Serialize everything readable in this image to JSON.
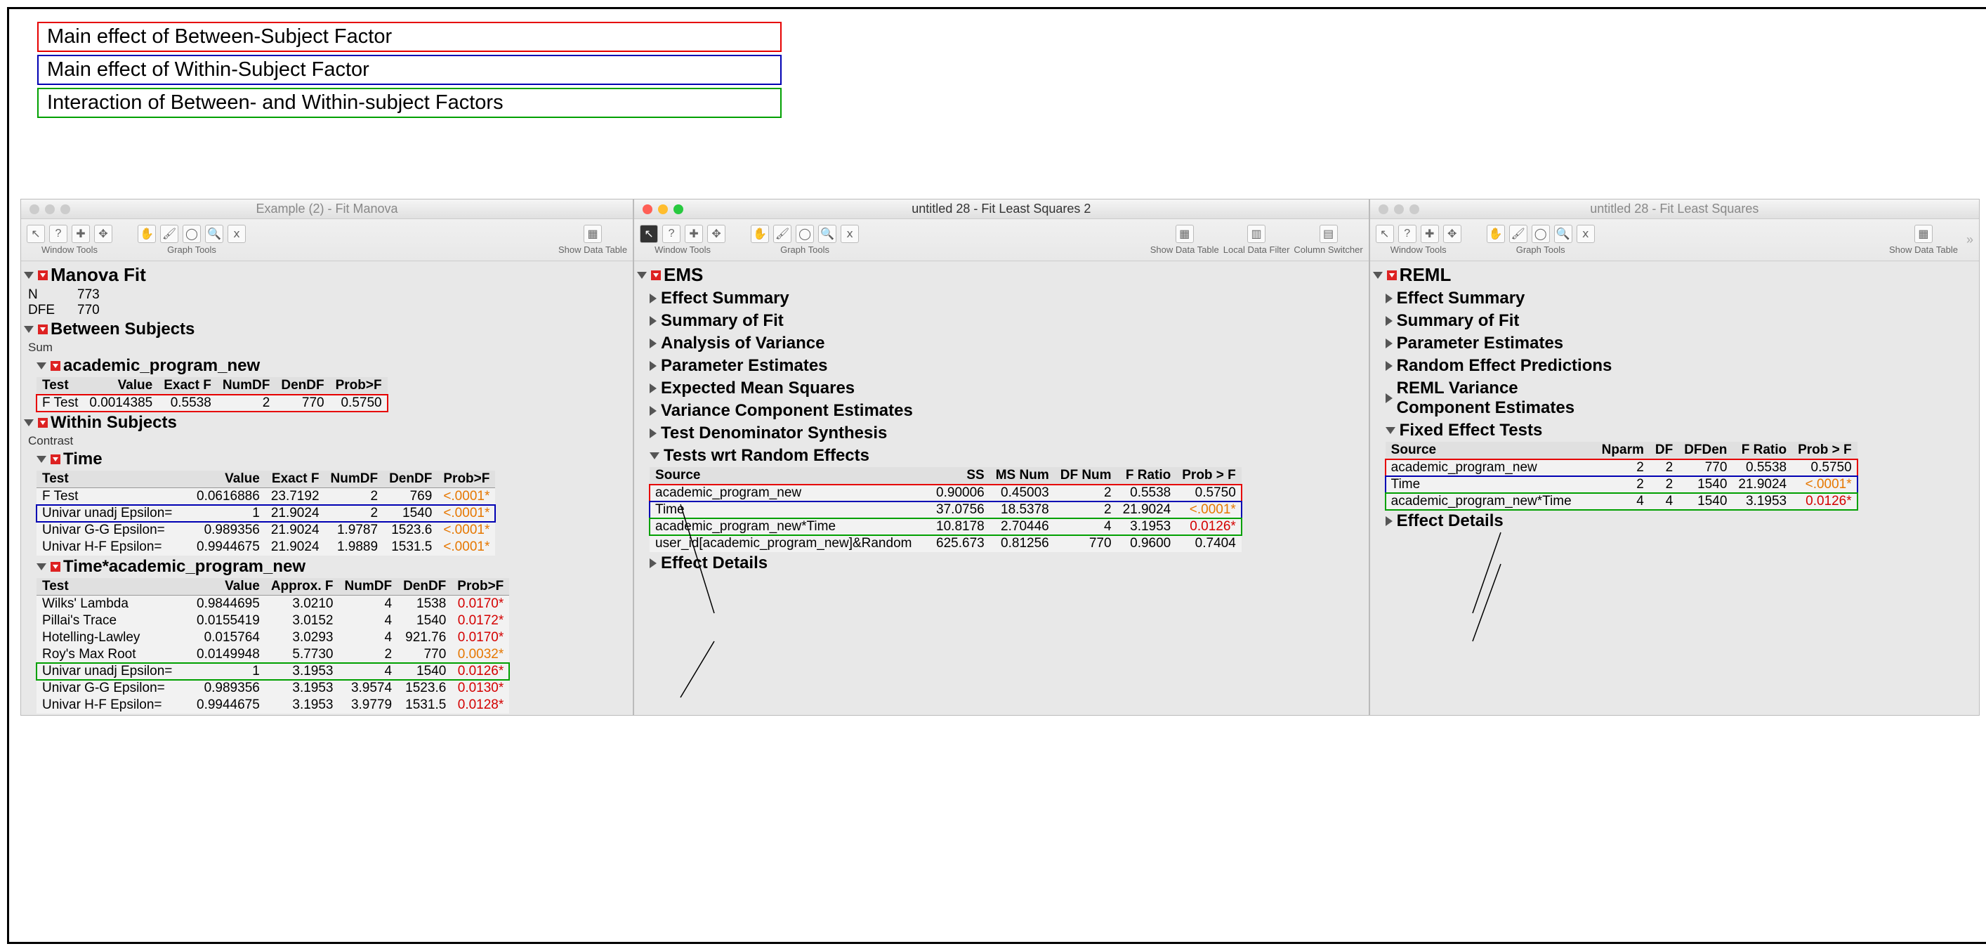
{
  "legend": {
    "between": "Main effect of Between-Subject Factor",
    "within": "Main effect of Within-Subject Factor",
    "interaction": "Interaction of Between- and Within-subject Factors"
  },
  "win1": {
    "title": "Example (2) - Fit Manova",
    "toolbar": {
      "window": "Window Tools",
      "graph": "Graph Tools",
      "show": "Show Data Table"
    },
    "header": "Manova Fit",
    "n_label": "N",
    "n": "773",
    "dfe_label": "DFE",
    "dfe": "770",
    "between_hdr": "Between Subjects",
    "sum": "Sum",
    "apn": "academic_program_new",
    "cols_ftest": {
      "test": "Test",
      "value": "Value",
      "exactf": "Exact F",
      "numdf": "NumDF",
      "dendf": "DenDF",
      "prob": "Prob>F"
    },
    "ftest_row": {
      "test": "F Test",
      "value": "0.0014385",
      "exactf": "0.5538",
      "numdf": "2",
      "dendf": "770",
      "prob": "0.5750"
    },
    "within_hdr": "Within Subjects",
    "contrast": "Contrast",
    "time_hdr": "Time",
    "time_rows": [
      {
        "test": "F Test",
        "value": "0.0616886",
        "exactf": "23.7192",
        "numdf": "2",
        "dendf": "769",
        "prob": "<.0001*",
        "cls": "sig-orange"
      },
      {
        "test": "Univar unadj Epsilon=",
        "value": "1",
        "exactf": "21.9024",
        "numdf": "2",
        "dendf": "1540",
        "prob": "<.0001*",
        "cls": "sig-orange",
        "hl": "hlb"
      },
      {
        "test": "Univar G-G   Epsilon=",
        "value": "0.989356",
        "exactf": "21.9024",
        "numdf": "1.9787",
        "dendf": "1523.6",
        "prob": "<.0001*",
        "cls": "sig-orange"
      },
      {
        "test": "Univar H-F   Epsilon=",
        "value": "0.9944675",
        "exactf": "21.9024",
        "numdf": "1.9889",
        "dendf": "1531.5",
        "prob": "<.0001*",
        "cls": "sig-orange"
      }
    ],
    "tap_hdr": "Time*academic_program_new",
    "cols_approx": {
      "test": "Test",
      "value": "Value",
      "approxf": "Approx. F",
      "numdf": "NumDF",
      "dendf": "DenDF",
      "prob": "Prob>F"
    },
    "tap_rows": [
      {
        "test": "Wilks' Lambda",
        "value": "0.9844695",
        "f": "3.0210",
        "numdf": "4",
        "dendf": "1538",
        "prob": "0.0170*",
        "cls": "sig-red"
      },
      {
        "test": "Pillai's Trace",
        "value": "0.0155419",
        "f": "3.0152",
        "numdf": "4",
        "dendf": "1540",
        "prob": "0.0172*",
        "cls": "sig-red"
      },
      {
        "test": "Hotelling-Lawley",
        "value": "0.015764",
        "f": "3.0293",
        "numdf": "4",
        "dendf": "921.76",
        "prob": "0.0170*",
        "cls": "sig-red"
      },
      {
        "test": "Roy's Max Root",
        "value": "0.0149948",
        "f": "5.7730",
        "numdf": "2",
        "dendf": "770",
        "prob": "0.0032*",
        "cls": "sig-orange"
      },
      {
        "test": "Univar unadj Epsilon=",
        "value": "1",
        "f": "3.1953",
        "numdf": "4",
        "dendf": "1540",
        "prob": "0.0126*",
        "cls": "sig-red",
        "hl": "hlg"
      },
      {
        "test": "Univar G-G   Epsilon=",
        "value": "0.989356",
        "f": "3.1953",
        "numdf": "3.9574",
        "dendf": "1523.6",
        "prob": "0.0130*",
        "cls": "sig-red"
      },
      {
        "test": "Univar H-F   Epsilon=",
        "value": "0.9944675",
        "f": "3.1953",
        "numdf": "3.9779",
        "dendf": "1531.5",
        "prob": "0.0128*",
        "cls": "sig-red"
      }
    ]
  },
  "win2": {
    "title": "untitled 28 - Fit Least Squares 2",
    "toolbar": {
      "window": "Window Tools",
      "graph": "Graph Tools",
      "show": "Show Data Table",
      "filter": "Local Data Filter",
      "cols": "Column Switcher"
    },
    "header": "EMS",
    "sections": [
      "Effect Summary",
      "Summary of Fit",
      "Analysis of Variance",
      "Parameter Estimates",
      "Expected Mean Squares",
      "Variance Component Estimates",
      "Test Denominator Synthesis"
    ],
    "tests_hdr": "Tests wrt Random Effects",
    "cols": {
      "source": "Source",
      "ss": "SS",
      "msnum": "MS Num",
      "dfnum": "DF Num",
      "fratio": "F Ratio",
      "prob": "Prob > F"
    },
    "rows": [
      {
        "source": "academic_program_new",
        "ss": "0.90006",
        "ms": "0.45003",
        "df": "2",
        "f": "0.5538",
        "p": "0.5750",
        "hl": "hlr"
      },
      {
        "source": "Time",
        "ss": "37.0756",
        "ms": "18.5378",
        "df": "2",
        "f": "21.9024",
        "p": "<.0001*",
        "cls": "sig-orange",
        "hl": "hlb"
      },
      {
        "source": "academic_program_new*Time",
        "ss": "10.8178",
        "ms": "2.70446",
        "df": "4",
        "f": "3.1953",
        "p": "0.0126*",
        "cls": "sig-red",
        "hl": "hlg"
      },
      {
        "source": "user_id[academic_program_new]&Random",
        "ss": "625.673",
        "ms": "0.81256",
        "df": "770",
        "f": "0.9600",
        "p": "0.7404"
      }
    ],
    "details": "Effect Details"
  },
  "win3": {
    "title": "untitled 28 - Fit Least Squares",
    "toolbar": {
      "window": "Window Tools",
      "graph": "Graph Tools",
      "show": "Show Data Table"
    },
    "header": "REML",
    "sections": [
      "Effect Summary",
      "Summary of Fit",
      "Parameter Estimates",
      "Random Effect Predictions"
    ],
    "reml_var": [
      "REML Variance",
      "Component Estimates"
    ],
    "tests_hdr": "Fixed Effect Tests",
    "cols": {
      "source": "Source",
      "nparm": "Nparm",
      "df": "DF",
      "dfden": "DFDen",
      "fratio": "F Ratio",
      "prob": "Prob > F"
    },
    "rows": [
      {
        "source": "academic_program_new",
        "nparm": "2",
        "df": "2",
        "dfden": "770",
        "f": "0.5538",
        "p": "0.5750",
        "hl": "hlr"
      },
      {
        "source": "Time",
        "nparm": "2",
        "df": "2",
        "dfden": "1540",
        "f": "21.9024",
        "p": "<.0001*",
        "cls": "sig-orange",
        "hl": "hlb"
      },
      {
        "source": "academic_program_new*Time",
        "nparm": "4",
        "df": "4",
        "dfden": "1540",
        "f": "3.1953",
        "p": "0.0126*",
        "cls": "sig-red",
        "hl": "hlg"
      }
    ],
    "details": "Effect Details"
  },
  "icons": {
    "arrow": "↖",
    "help": "?",
    "plus": "✚",
    "move": "✥",
    "hand": "✋",
    "brush": "🖌",
    "lasso": "◯",
    "zoom": "🔍",
    "xy": "ⅹ"
  }
}
